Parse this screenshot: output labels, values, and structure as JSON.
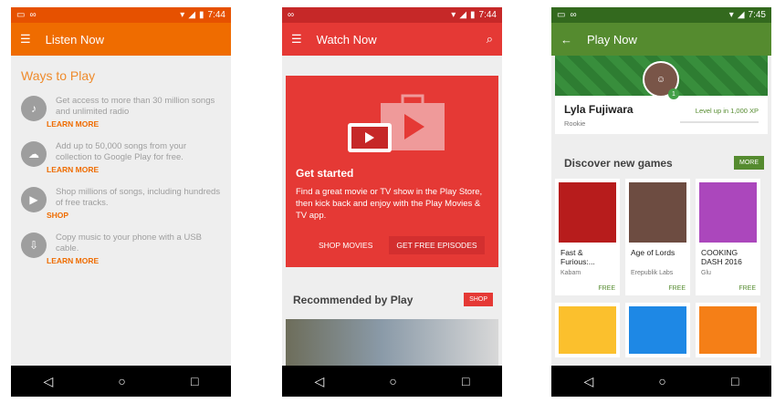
{
  "phones": {
    "listen": {
      "time": "7:44",
      "title": "Listen Now",
      "section_title": "Ways to Play",
      "features": [
        {
          "icon": "music-icon",
          "text": "Get access to more than 30 million songs and unlimited radio",
          "link": "LEARN MORE"
        },
        {
          "icon": "cloud-upload-icon",
          "text": "Add up to 50,000 songs from your collection to Google Play for free.",
          "link": "LEARN MORE"
        },
        {
          "icon": "shop-icon",
          "text": "Shop millions of songs, including hundreds of free tracks.",
          "link": "SHOP"
        },
        {
          "icon": "usb-icon",
          "text": "Copy music to your phone with a USB cable.",
          "link": "LEARN MORE"
        }
      ]
    },
    "watch": {
      "time": "7:44",
      "title": "Watch Now",
      "hero_title": "Get started",
      "hero_desc": "Find a great movie or TV show in the Play Store, then kick back and enjoy with the Play Movies & TV app.",
      "btn_shop": "SHOP MOVIES",
      "btn_free": "GET FREE EPISODES",
      "rec_title": "Recommended by Play",
      "rec_btn": "SHOP"
    },
    "play": {
      "time": "7:45",
      "title": "Play Now",
      "profile_name": "Lyla Fujiwara",
      "profile_rank": "Rookie",
      "profile_level_text": "Level up in 1,000 XP",
      "level": "1",
      "section_title": "Discover new games",
      "more_btn": "MORE",
      "games": [
        {
          "title": "Fast & Furious:...",
          "dev": "Kabam",
          "price": "FREE",
          "color": "#b71c1c"
        },
        {
          "title": "Age of Lords",
          "dev": "Erepublik Labs",
          "price": "FREE",
          "color": "#6d4c41"
        },
        {
          "title": "COOKING DASH 2016",
          "dev": "Glu",
          "price": "FREE",
          "color": "#ab47bc"
        }
      ]
    }
  },
  "colors": {
    "listen_accent": "#ef6c00",
    "watch_accent": "#e53935",
    "play_accent": "#558b2f"
  }
}
